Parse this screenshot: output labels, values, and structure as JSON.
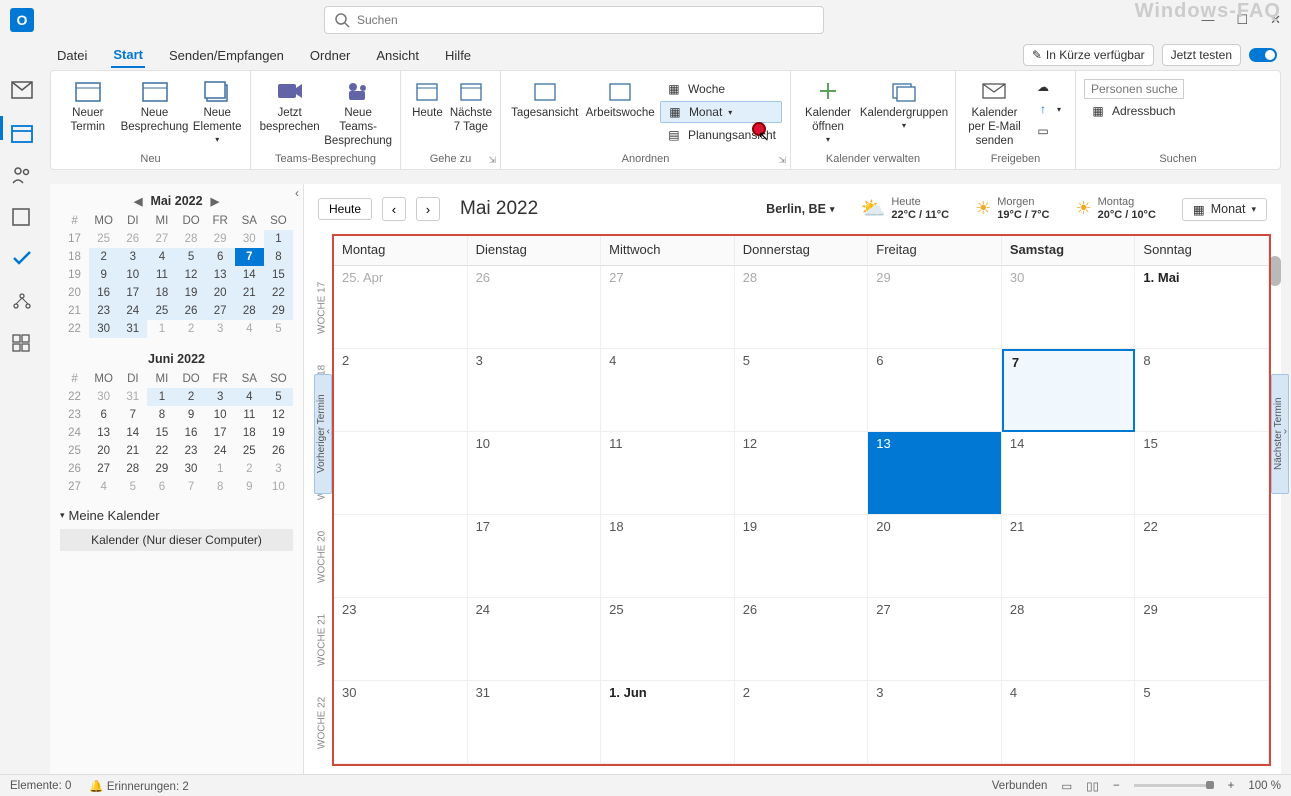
{
  "app": {
    "icon_letter": "O"
  },
  "search": {
    "placeholder": "Suchen"
  },
  "watermark": "Windows-FAQ",
  "window_controls": {
    "minimize": "—",
    "maximize": "☐",
    "close": "✕"
  },
  "tabs": [
    "Datei",
    "Start",
    "Senden/Empfangen",
    "Ordner",
    "Ansicht",
    "Hilfe"
  ],
  "active_tab": "Start",
  "coming_soon": "In Kürze verfügbar",
  "try_now": "Jetzt testen",
  "ribbon": {
    "neu": {
      "label": "Neu",
      "termin": "Neuer\nTermin",
      "besprechung": "Neue\nBesprechung",
      "elemente": "Neue\nElemente"
    },
    "teams": {
      "label": "Teams-Besprechung",
      "jetzt": "Jetzt\nbesprechen",
      "neue": "Neue Teams-\nBesprechung"
    },
    "gehe": {
      "label": "Gehe zu",
      "heute": "Heute",
      "n7": "Nächste\n7 Tage"
    },
    "anordnen": {
      "label": "Anordnen",
      "tag": "Tagesansicht",
      "arbeit": "Arbeitswoche",
      "woche": "Woche",
      "monat": "Monat",
      "plan": "Planungsansicht"
    },
    "verwalten": {
      "label": "Kalender verwalten",
      "offnen": "Kalender\nöffnen",
      "gruppen": "Kalendergruppen"
    },
    "freigeben": {
      "label": "Freigeben",
      "email": "Kalender per\nE-Mail senden"
    },
    "suchen": {
      "label": "Suchen",
      "personen": "Personen suchen",
      "adressbuch": "Adressbuch"
    }
  },
  "minical1": {
    "title": "Mai 2022",
    "dow": [
      "#",
      "MO",
      "DI",
      "MI",
      "DO",
      "FR",
      "SA",
      "SO"
    ],
    "rows": [
      [
        "17",
        "25",
        "26",
        "27",
        "28",
        "29",
        "30",
        "1"
      ],
      [
        "18",
        "2",
        "3",
        "4",
        "5",
        "6",
        "7",
        "8"
      ],
      [
        "19",
        "9",
        "10",
        "11",
        "12",
        "13",
        "14",
        "15"
      ],
      [
        "20",
        "16",
        "17",
        "18",
        "19",
        "20",
        "21",
        "22"
      ],
      [
        "21",
        "23",
        "24",
        "25",
        "26",
        "27",
        "28",
        "29"
      ],
      [
        "22",
        "30",
        "31",
        "1",
        "2",
        "3",
        "4",
        "5"
      ]
    ],
    "today": "7"
  },
  "minical2": {
    "title": "Juni 2022",
    "dow": [
      "#",
      "MO",
      "DI",
      "MI",
      "DO",
      "FR",
      "SA",
      "SO"
    ],
    "rows": [
      [
        "22",
        "30",
        "31",
        "1",
        "2",
        "3",
        "4",
        "5"
      ],
      [
        "23",
        "6",
        "7",
        "8",
        "9",
        "10",
        "11",
        "12"
      ],
      [
        "24",
        "13",
        "14",
        "15",
        "16",
        "17",
        "18",
        "19"
      ],
      [
        "25",
        "20",
        "21",
        "22",
        "23",
        "24",
        "25",
        "26"
      ],
      [
        "26",
        "27",
        "28",
        "29",
        "30",
        "1",
        "2",
        "3"
      ],
      [
        "27",
        "4",
        "5",
        "6",
        "7",
        "8",
        "9",
        "10"
      ]
    ]
  },
  "my_calendars": {
    "header": "Meine Kalender",
    "item": "Kalender (Nur dieser Computer)"
  },
  "calendar": {
    "today_btn": "Heute",
    "title": "Mai 2022",
    "location": "Berlin, BE",
    "weather": [
      {
        "label": "Heute",
        "temp": "22°C / 11°C"
      },
      {
        "label": "Morgen",
        "temp": "19°C / 7°C"
      },
      {
        "label": "Montag",
        "temp": "20°C / 10°C"
      }
    ],
    "view": "Monat",
    "day_headers": [
      "Montag",
      "Dienstag",
      "Mittwoch",
      "Donnerstag",
      "Freitag",
      "Samstag",
      "Sonntag"
    ],
    "weeks": [
      "WOCHE 17",
      "WOCHE 18",
      "WOCHE 19",
      "WOCHE 20",
      "WOCHE 21",
      "WOCHE 22"
    ],
    "cells": [
      [
        "25. Apr",
        "26",
        "27",
        "28",
        "29",
        "30",
        "1. Mai"
      ],
      [
        "2",
        "3",
        "4",
        "5",
        "6",
        "7",
        "8"
      ],
      [
        "",
        "10",
        "11",
        "12",
        "13",
        "14",
        "15"
      ],
      [
        "",
        "17",
        "18",
        "19",
        "20",
        "21",
        "22"
      ],
      [
        "23",
        "24",
        "25",
        "26",
        "27",
        "28",
        "29"
      ],
      [
        "30",
        "31",
        "1. Jun",
        "2",
        "3",
        "4",
        "5"
      ]
    ],
    "prev_appt": "Vorheriger Termin",
    "next_appt": "Nächster Termin"
  },
  "status": {
    "elements": "Elemente: 0",
    "reminders": "Erinnerungen: 2",
    "connected": "Verbunden",
    "zoom": "100 %"
  }
}
